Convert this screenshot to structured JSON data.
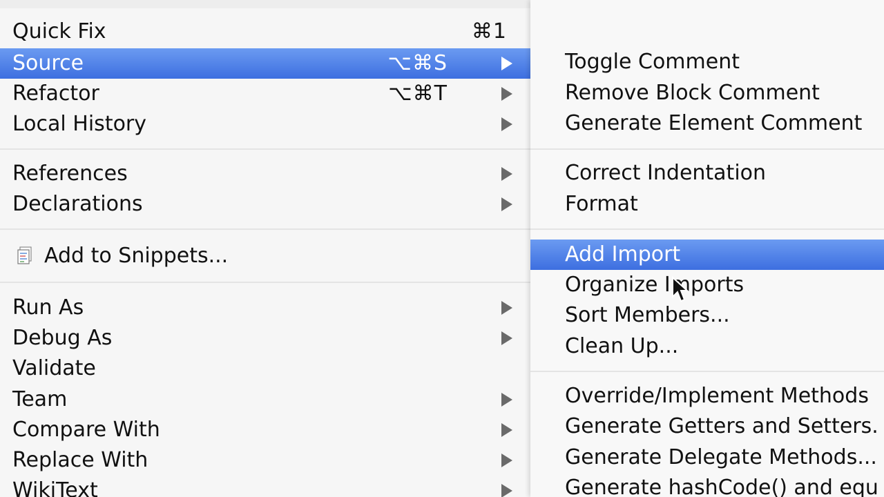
{
  "main_menu": {
    "items": [
      {
        "label": "Quick Fix",
        "shortcut": "⌘1"
      },
      {
        "label": "Source",
        "shortcut": "⌥⌘S"
      },
      {
        "label": "Refactor",
        "shortcut": "⌥⌘T"
      },
      {
        "label": "Local History"
      },
      {
        "label": "References"
      },
      {
        "label": "Declarations"
      },
      {
        "label": "Add to Snippets..."
      },
      {
        "label": "Run As"
      },
      {
        "label": "Debug As"
      },
      {
        "label": "Validate"
      },
      {
        "label": "Team"
      },
      {
        "label": "Compare With"
      },
      {
        "label": "Replace With"
      },
      {
        "label": "WikiText"
      }
    ]
  },
  "source_submenu": {
    "items": [
      {
        "label": "Toggle Comment"
      },
      {
        "label": "Remove Block Comment"
      },
      {
        "label": "Generate Element Comment"
      },
      {
        "label": "Correct Indentation"
      },
      {
        "label": "Format"
      },
      {
        "label": "Add Import"
      },
      {
        "label": "Organize Imports"
      },
      {
        "label": "Sort Members..."
      },
      {
        "label": "Clean Up..."
      },
      {
        "label": "Override/Implement Methods"
      },
      {
        "label": "Generate Getters and Setters."
      },
      {
        "label": "Generate Delegate Methods..."
      },
      {
        "label": "Generate hashCode() and equ"
      }
    ]
  },
  "colors": {
    "highlight": "#3d6fe0",
    "menu_background": "#f6f6f6",
    "arrow": "#6a6a6a"
  },
  "icons": {
    "snippets": "snippet-icon",
    "submenu_arrow": "submenu-arrow-icon",
    "pointer": "mouse-pointer-icon"
  }
}
